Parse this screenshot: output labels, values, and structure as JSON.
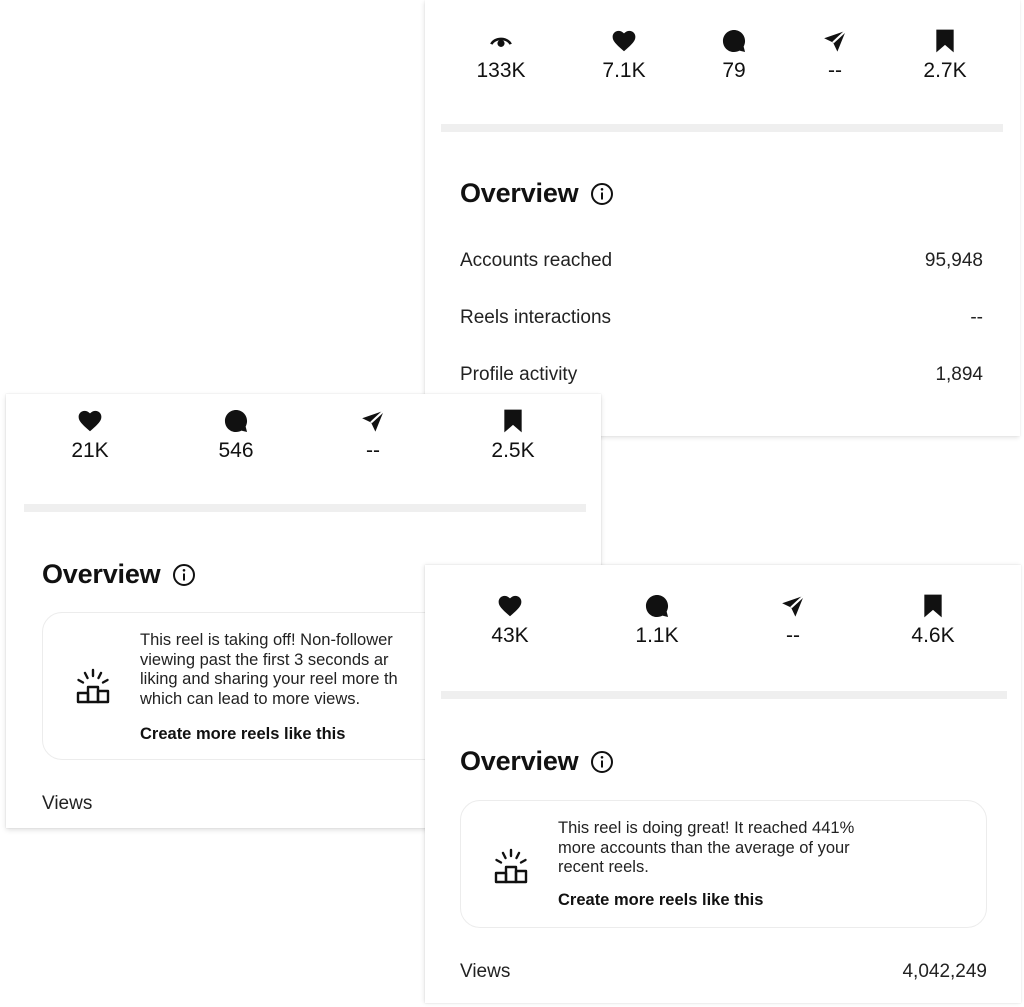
{
  "card_top": {
    "stats": [
      {
        "icon": "eye-icon",
        "value": "133K"
      },
      {
        "icon": "heart-icon",
        "value": "7.1K"
      },
      {
        "icon": "comment-icon",
        "value": "79"
      },
      {
        "icon": "send-icon",
        "value": "--"
      },
      {
        "icon": "bookmark-icon",
        "value": "2.7K"
      }
    ],
    "overview_title": "Overview",
    "rows": [
      {
        "label": "Accounts reached",
        "value": "95,948"
      },
      {
        "label": "Reels interactions",
        "value": "--"
      },
      {
        "label": "Profile activity",
        "value": "1,894"
      }
    ]
  },
  "card_left": {
    "stats": [
      {
        "icon": "heart-icon",
        "value": "21K"
      },
      {
        "icon": "comment-icon",
        "value": "546"
      },
      {
        "icon": "send-icon",
        "value": "--"
      },
      {
        "icon": "bookmark-icon",
        "value": "2.5K"
      }
    ],
    "overview_title": "Overview",
    "insight_lines": [
      "This reel is taking off! Non-follower",
      "viewing past the first 3 seconds ar",
      "liking and sharing your reel more th",
      "which can lead to more views."
    ],
    "insight_link": "Create more reels like this",
    "views_label": "Views"
  },
  "card_bottom": {
    "stats": [
      {
        "icon": "heart-icon",
        "value": "43K"
      },
      {
        "icon": "comment-icon",
        "value": "1.1K"
      },
      {
        "icon": "send-icon",
        "value": "--"
      },
      {
        "icon": "bookmark-icon",
        "value": "4.6K"
      }
    ],
    "overview_title": "Overview",
    "insight_lines": [
      "This reel is doing great! It reached 441%",
      "more accounts than the average of your",
      "recent reels."
    ],
    "insight_link": "Create more reels like this",
    "views_label": "Views",
    "views_value": "4,042,249"
  }
}
